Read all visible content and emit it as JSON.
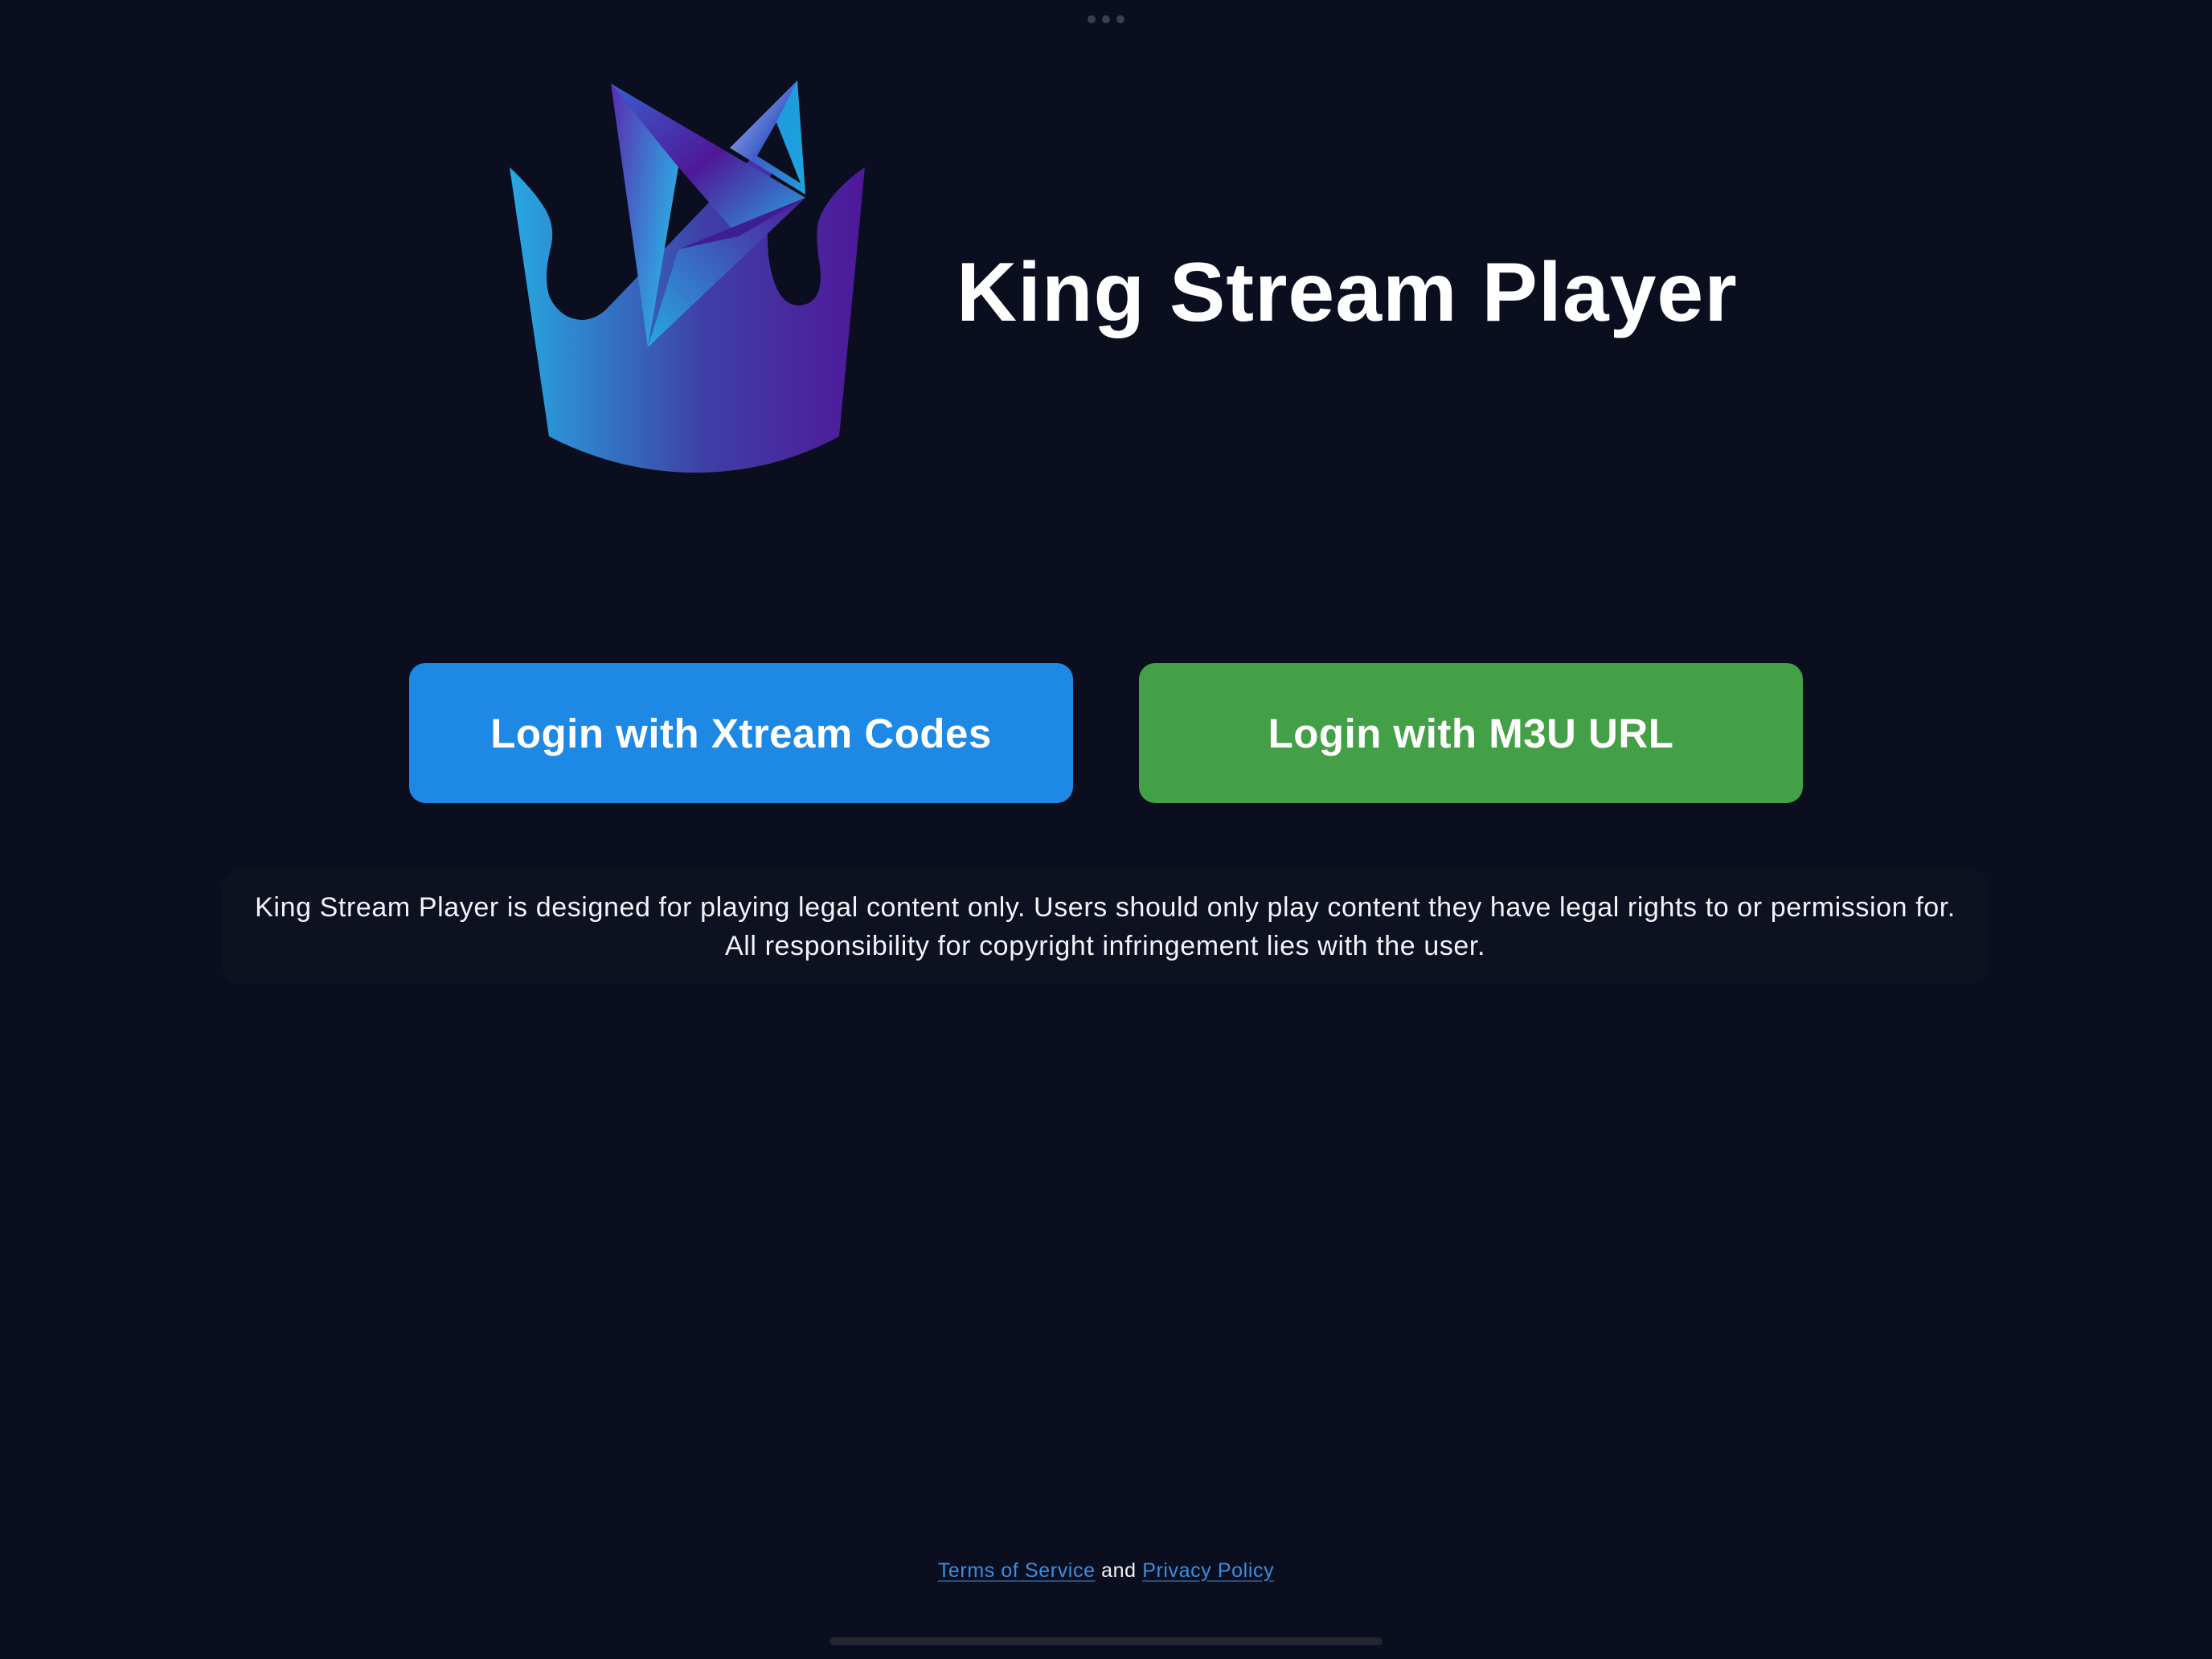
{
  "app": {
    "title": "King Stream Player",
    "logo_icon": "crown-play-logo-icon"
  },
  "actions": {
    "xtream_label": "Login with Xtream Codes",
    "m3u_label": "Login with M3U URL"
  },
  "disclaimer": {
    "text": "King Stream Player is designed for playing legal content only. Users should only play content they have legal rights to or permission for. All responsibility for copyright infringement lies with the user."
  },
  "footer": {
    "terms_label": "Terms of Service",
    "conjunction": " and ",
    "privacy_label": "Privacy Policy"
  },
  "colors": {
    "background": "#0a0e1f",
    "xtream_button": "#1e88e5",
    "m3u_button": "#43a047",
    "link": "#3a8fe0",
    "logo_gradient_start": "#27a9e1",
    "logo_gradient_end": "#4f1899"
  }
}
